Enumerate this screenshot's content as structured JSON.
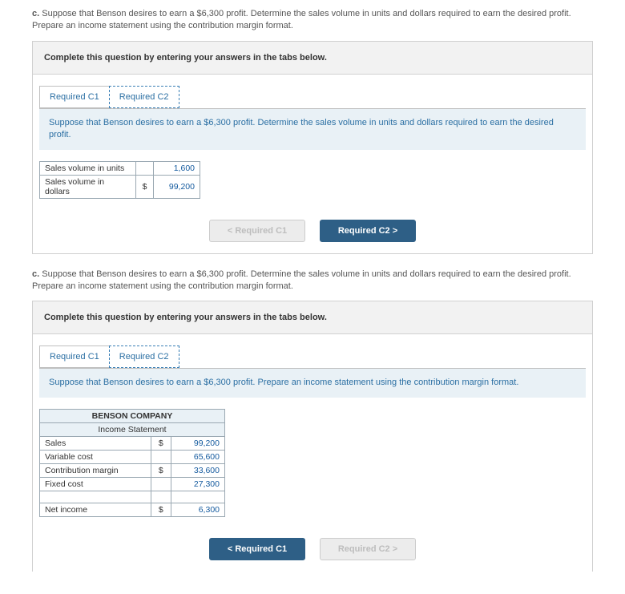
{
  "q1": {
    "prefix": "c.",
    "text": "Suppose that Benson desires to earn a $6,300 profit. Determine the sales volume in units and dollars required to earn the desired profit. Prepare an income statement using the contribution margin format.",
    "instruction": "Complete this question by entering your answers in the tabs below.",
    "tab1": "Required C1",
    "tab2": "Required C2",
    "subprompt": "Suppose that Benson desires to earn a $6,300 profit. Determine the sales volume in units and dollars required to earn the desired profit.",
    "row1_label": "Sales volume in units",
    "row1_val": "1,600",
    "row2_label": "Sales volume in dollars",
    "row2_sym": "$",
    "row2_val": "99,200",
    "nav_prev": "<  Required C1",
    "nav_next": "Required C2  >"
  },
  "q2": {
    "prefix": "c.",
    "text": "Suppose that Benson desires to earn a $6,300 profit. Determine the sales volume in units and dollars required to earn the desired profit. Prepare an income statement using the contribution margin format.",
    "instruction": "Complete this question by entering your answers in the tabs below.",
    "tab1": "Required C1",
    "tab2": "Required C2",
    "subprompt": "Suppose that Benson desires to earn a $6,300 profit. Prepare an income statement using the contribution margin format.",
    "company": "BENSON COMPANY",
    "stmt_title": "Income Statement",
    "rows": {
      "sales_lbl": "Sales",
      "sales_sym": "$",
      "sales_val": "99,200",
      "var_lbl": "Variable cost",
      "var_val": "65,600",
      "cm_lbl": "Contribution margin",
      "cm_sym": "$",
      "cm_val": "33,600",
      "fc_lbl": "Fixed cost",
      "fc_val": "27,300",
      "ni_lbl": "Net income",
      "ni_sym": "$",
      "ni_val": "6,300"
    },
    "nav_prev": "<  Required C1",
    "nav_next": "Required C2  >"
  }
}
